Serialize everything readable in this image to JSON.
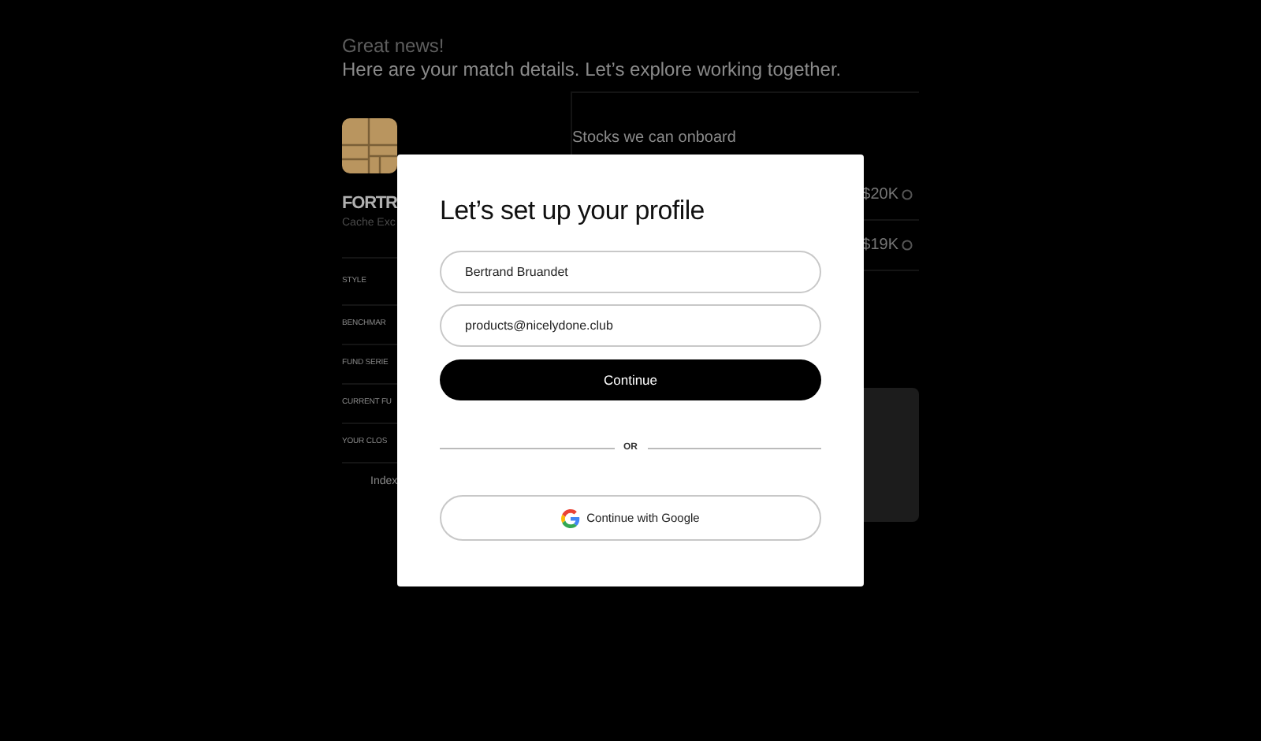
{
  "background": {
    "eyebrow": "Great news!",
    "headline": "Here are your match details. Let’s explore working together.",
    "fund": {
      "name": "FORTR",
      "subtitle": "Cache Exc"
    },
    "details": [
      {
        "label": "STYLE"
      },
      {
        "label": "BENCHMAR"
      },
      {
        "label": "FUND SERIE"
      },
      {
        "label": "CURRENT FU"
      },
      {
        "label": "YOUR CLOS"
      }
    ],
    "index_label": "Index",
    "stocks_title": "Stocks we can onboard",
    "stocks": [
      {
        "amount": "$20K"
      },
      {
        "amount": "$19K"
      }
    ]
  },
  "modal": {
    "title": "Let’s set up your profile",
    "fields": [
      {
        "value": "Bertrand Bruandet"
      },
      {
        "value": "products@nicelydone.club"
      }
    ],
    "continue_button": "Continue",
    "divider": "OR",
    "google_button": "Continue with Google"
  }
}
